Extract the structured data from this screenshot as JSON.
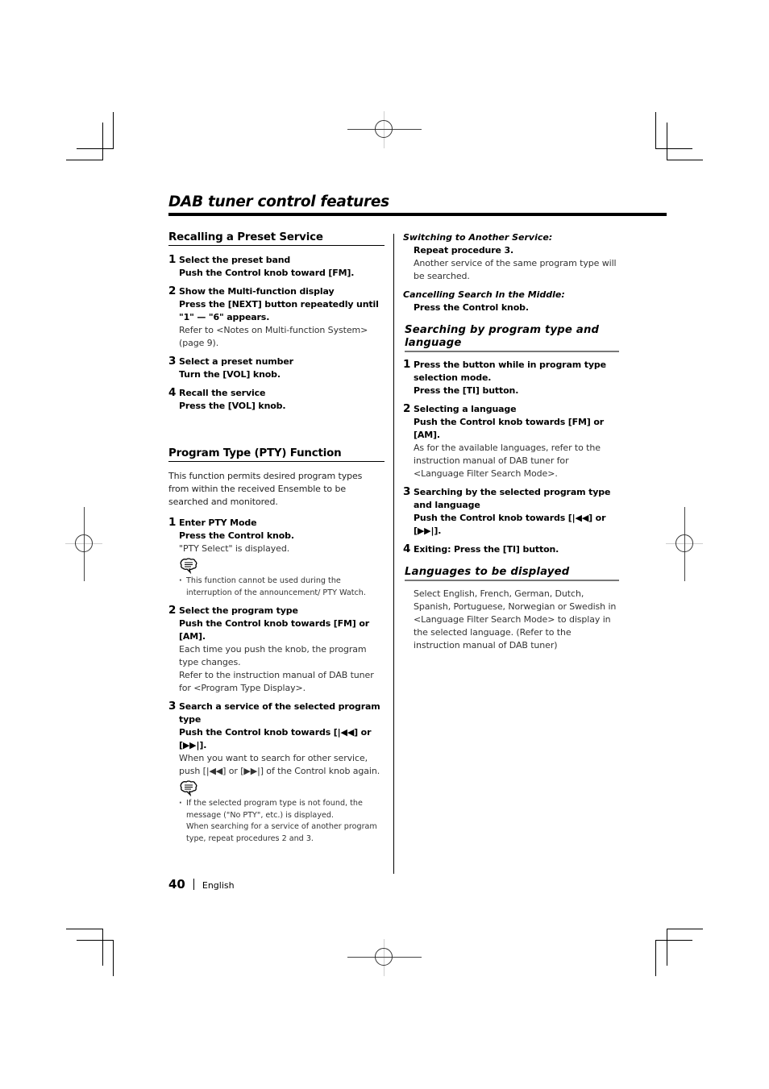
{
  "page": {
    "title": "DAB tuner control features",
    "page_number": "40",
    "language": "English"
  },
  "left_column": {
    "recall_section": {
      "heading": "Recalling a Preset Service",
      "steps": [
        {
          "num": "1",
          "title": "Select the preset band",
          "action": "Push the Control knob toward [FM].",
          "notes": []
        },
        {
          "num": "2",
          "title": "Show the Multi-function display",
          "action": "Press the [NEXT] button repeatedly until \"1\" — \"6\" appears.",
          "notes": [
            "Refer to <Notes on Multi-function System> (page 9)."
          ]
        },
        {
          "num": "3",
          "title": "Select a preset number",
          "action": "Turn the [VOL] knob.",
          "notes": []
        },
        {
          "num": "4",
          "title": "Recall the service",
          "action": "Press the [VOL] knob.",
          "notes": []
        }
      ]
    },
    "pty_section": {
      "heading": "Program Type (PTY) Function",
      "intro": "This function permits desired program types from within the received Ensemble to be searched and monitored.",
      "steps": [
        {
          "num": "1",
          "title": "Enter PTY Mode",
          "action": "Press the Control knob.",
          "notes": [
            "\"PTY Select\" is displayed."
          ],
          "bullets": [
            "This function cannot be used during the interruption of the announcement/ PTY Watch."
          ]
        },
        {
          "num": "2",
          "title": "Select the program type",
          "action": "Push the Control knob towards [FM] or [AM].",
          "notes": [
            "Each time you push the knob, the program type changes.",
            "Refer to the instruction manual of DAB tuner for <Program Type Display>."
          ]
        },
        {
          "num": "3",
          "title": "Search a service of the selected program type",
          "action": "Push the Control knob towards [|◀◀] or [▶▶|].",
          "notes": [
            "When you want to search for other service, push [|◀◀] or [▶▶|] of the Control knob again."
          ],
          "bullets": [
            "If the selected program type is not found, the message (\"No PTY\", etc.) is displayed.",
            "When searching for a service of another program type, repeat procedures 2 and 3."
          ]
        }
      ]
    }
  },
  "right_column": {
    "switching": {
      "label": "Switching to Another Service:",
      "action": "Repeat procedure 3.",
      "note": "Another service of the same program type will be searched."
    },
    "cancelling": {
      "label": "Cancelling Search In the Middle:",
      "action": "Press the Control knob."
    },
    "search_lang_section": {
      "heading": "Searching by program type and language",
      "steps": [
        {
          "num": "1",
          "title": "Press the button while in program type selection mode.",
          "action": "Press the [TI] button.",
          "notes": []
        },
        {
          "num": "2",
          "title": "Selecting a language",
          "action": "Push the Control knob towards [FM] or [AM].",
          "notes": [
            "As for the available languages, refer to the instruction manual of DAB tuner for <Language Filter Search Mode>."
          ]
        },
        {
          "num": "3",
          "title": "Searching by the selected program type and language",
          "action": "Push the Control knob towards [|◀◀] or [▶▶|].",
          "notes": []
        },
        {
          "num": "4",
          "title": "Exiting: Press the [TI] button.",
          "action": "",
          "notes": []
        }
      ]
    },
    "languages_section": {
      "heading": "Languages to be displayed",
      "body": "Select English, French, German, Dutch, Spanish, Portuguese, Norwegian or Swedish in <Language Filter Search Mode> to display in the selected language. (Refer to the instruction manual of DAB tuner)"
    }
  },
  "icons": {
    "note": "note-speech-bubble-icon",
    "registration": "registration-crosshair-icon",
    "crop": "crop-mark-icon"
  }
}
